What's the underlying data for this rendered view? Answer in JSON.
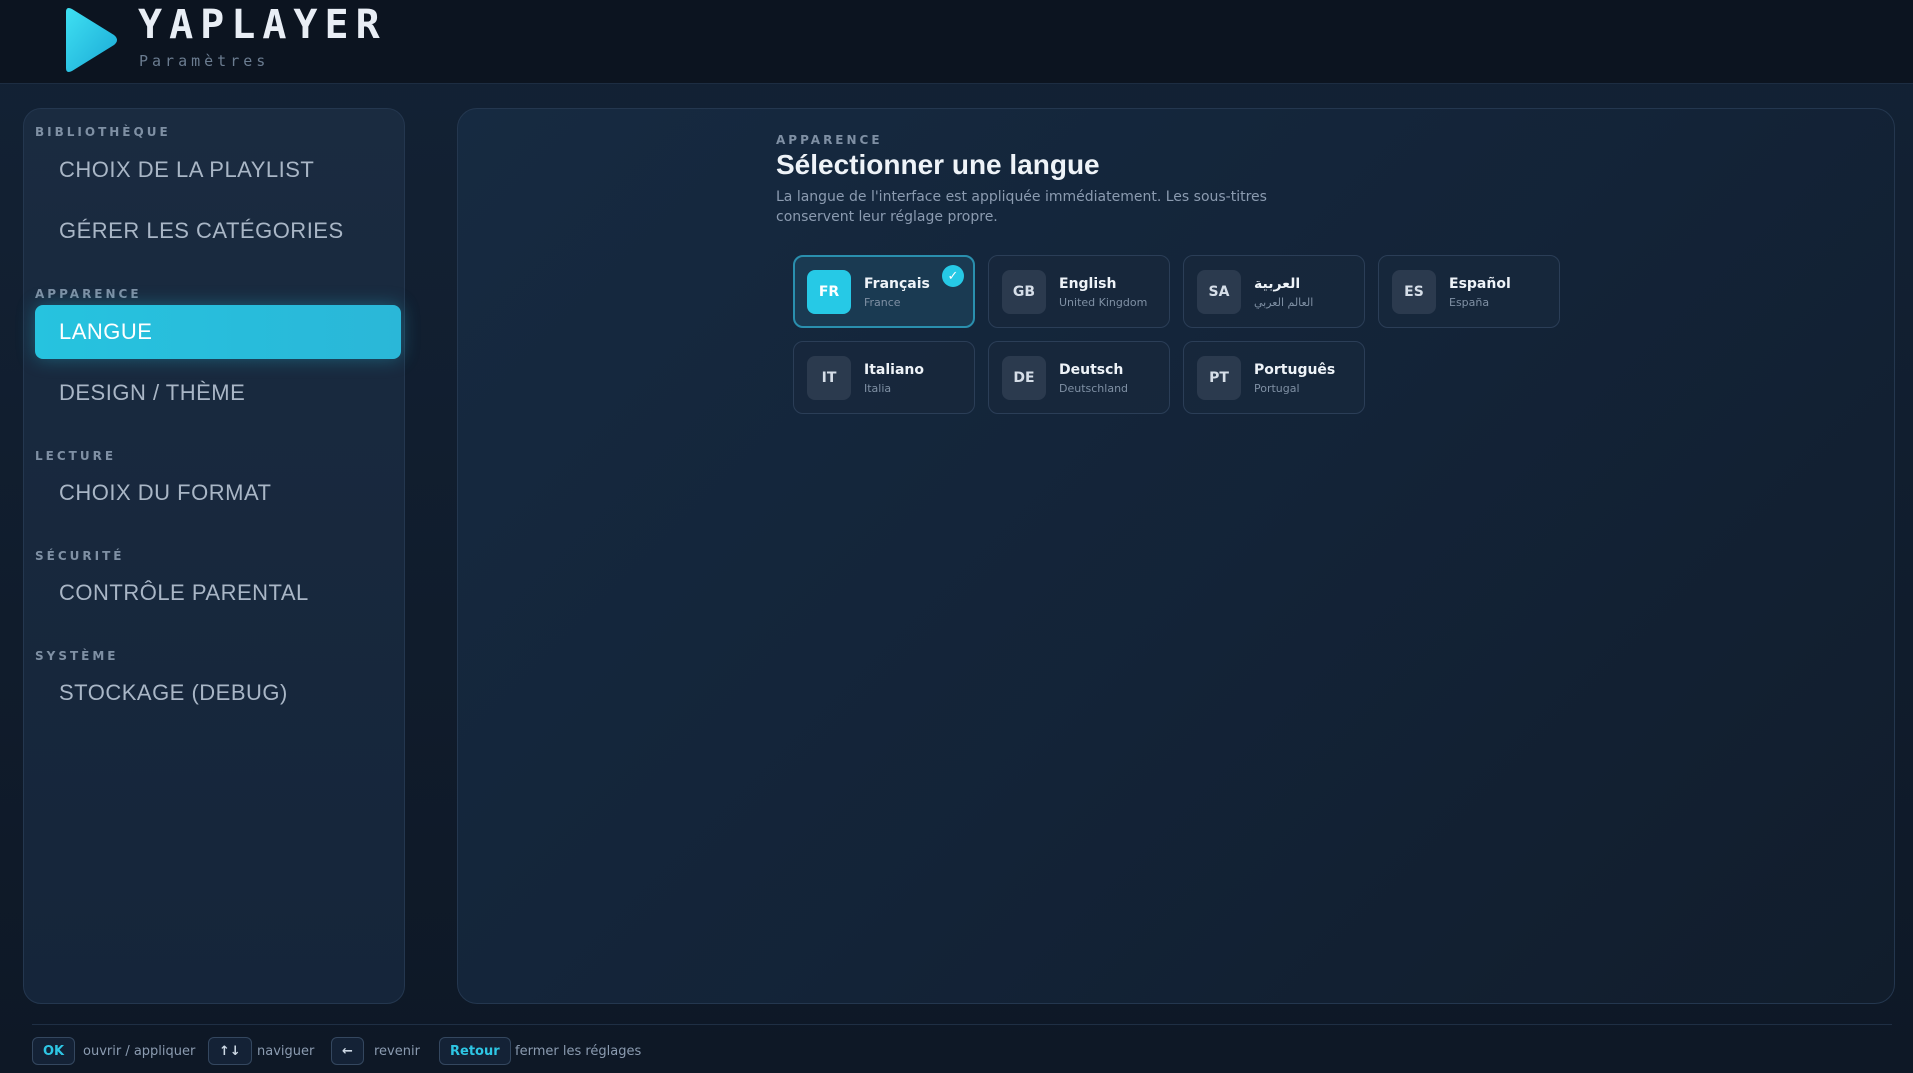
{
  "header": {
    "title": "YAPLAYER",
    "subtitle": "Paramètres",
    "logo_icon": "play-triangle-icon",
    "accent_color": "#26c9e6"
  },
  "sidebar": {
    "sections": [
      {
        "label": "BIBLIOTHÈQUE",
        "items": [
          "CHOIX DE LA PLAYLIST",
          "GÉRER LES CATÉGORIES"
        ]
      },
      {
        "label": "APPARENCE",
        "items": [
          "LANGUE",
          "DESIGN / THÈME"
        ]
      },
      {
        "label": "LECTURE",
        "items": [
          "CHOIX DU FORMAT"
        ]
      },
      {
        "label": "SÉCURITÉ",
        "items": [
          "CONTRÔLE PARENTAL"
        ]
      },
      {
        "label": "SYSTÈME",
        "items": [
          "STOCKAGE (DEBUG)"
        ]
      }
    ],
    "active_item": "LANGUE"
  },
  "main": {
    "section_label": "APPARENCE",
    "title": "Sélectionner une langue",
    "description": "La langue de l'interface est appliquée immédiatement. Les sous-titres conservent leur réglage propre.",
    "languages": [
      {
        "code": "FR",
        "name": "Français",
        "region": "France",
        "selected": true
      },
      {
        "code": "GB",
        "name": "English",
        "region": "United Kingdom",
        "selected": false
      },
      {
        "code": "SA",
        "name": "العربية",
        "region": "العالم العربي",
        "selected": false
      },
      {
        "code": "ES",
        "name": "Español",
        "region": "España",
        "selected": false
      },
      {
        "code": "IT",
        "name": "Italiano",
        "region": "Italia",
        "selected": false
      },
      {
        "code": "DE",
        "name": "Deutsch",
        "region": "Deutschland",
        "selected": false
      },
      {
        "code": "PT",
        "name": "Português",
        "region": "Portugal",
        "selected": false
      }
    ],
    "selected_check": "✓"
  },
  "footer": {
    "hints": [
      {
        "key": "OK",
        "text": "ouvrir / appliquer"
      },
      {
        "key": "↑↓",
        "text": "naviguer"
      },
      {
        "key": "←",
        "text": "revenir"
      },
      {
        "key": "Retour",
        "text": "fermer les réglages"
      }
    ]
  }
}
